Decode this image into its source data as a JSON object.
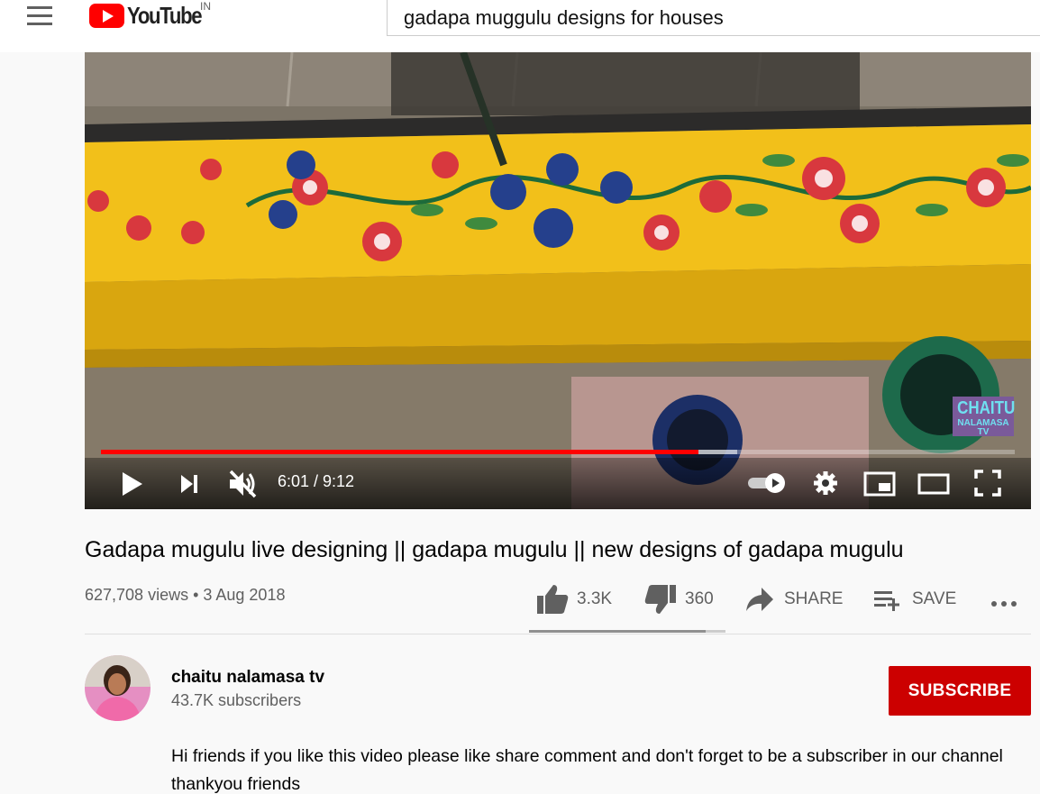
{
  "header": {
    "logo_text": "YouTube",
    "country_code": "IN",
    "search_value": "gadapa muggulu designs for houses"
  },
  "player": {
    "current_time": "6:01",
    "duration": "9:12",
    "time_display": "6:01 / 9:12",
    "played_fraction": 0.654,
    "buffered_fraction": 0.696,
    "muted": true,
    "watermark_line1": "CHAITU",
    "watermark_line2": "NALAMASA TV"
  },
  "video": {
    "title": "Gadapa mugulu live designing || gadapa mugulu || new designs of gadapa mugulu",
    "views_date": "627,708 views • 3 Aug 2018",
    "likes": "3.3K",
    "dislikes": "360",
    "like_fraction": 0.9,
    "share_label": "SHARE",
    "save_label": "SAVE"
  },
  "channel": {
    "name": "chaitu nalamasa tv",
    "subscribers": "43.7K subscribers",
    "subscribe_label": "SUBSCRIBE",
    "description": "Hi friends if you like this video please like share comment and don't forget to be a subscriber in our channel thankyou friends"
  },
  "colors": {
    "brand_red": "#ff0000",
    "subscribe_red": "#cc0000",
    "meta_gray": "#606060"
  },
  "icons": [
    "menu-icon",
    "youtube-play-icon",
    "play-icon",
    "next-icon",
    "mute-icon",
    "autoplay-toggle-icon",
    "settings-icon",
    "miniplayer-icon",
    "theater-icon",
    "fullscreen-icon",
    "like-icon",
    "dislike-icon",
    "share-icon",
    "save-playlist-icon",
    "more-icon"
  ]
}
